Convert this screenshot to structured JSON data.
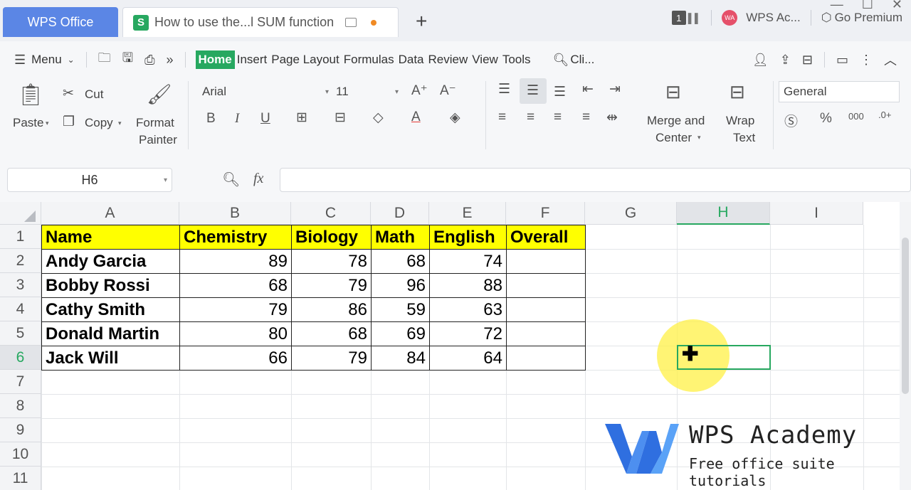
{
  "titlebar": {
    "app_tab": "WPS Office",
    "doc_tab": "How to use the...l SUM function",
    "doc_icon": "S",
    "new_tab": "+",
    "window_count": "1",
    "account_avatar": "WA",
    "account_name": "WPS Ac...",
    "premium": "Go Premium",
    "min": "—",
    "max": "☐",
    "close": "✕"
  },
  "menu": {
    "menu_label": "Menu",
    "more": "»",
    "tabs": [
      "Home",
      "Insert",
      "Page Layout",
      "Formulas",
      "Data",
      "Review",
      "View",
      "Tools"
    ],
    "search": "Cli..."
  },
  "ribbon": {
    "paste": "Paste",
    "cut": "Cut",
    "copy": "Copy",
    "format_painter_1": "Format",
    "format_painter_2": "Painter",
    "font_name": "Arial",
    "font_size": "11",
    "bold": "B",
    "italic": "I",
    "underline": "U",
    "merge_1": "Merge and",
    "merge_2": "Center",
    "wrap_1": "Wrap",
    "wrap_2": "Text",
    "number_format": "General"
  },
  "formula_bar": {
    "name_box": "H6",
    "fx": "fx",
    "formula": ""
  },
  "sheet": {
    "columns": [
      "A",
      "B",
      "C",
      "D",
      "E",
      "F",
      "G",
      "H",
      "I"
    ],
    "rows": [
      "1",
      "2",
      "3",
      "4",
      "5",
      "6",
      "7",
      "8",
      "9",
      "10",
      "11"
    ],
    "header": [
      "Name",
      "Chemistry",
      "Biology",
      "Math",
      "English",
      "Overall"
    ],
    "data": [
      [
        "Andy Garcia",
        "89",
        "78",
        "68",
        "74",
        ""
      ],
      [
        "Bobby Rossi",
        "68",
        "79",
        "96",
        "88",
        ""
      ],
      [
        "Cathy Smith",
        "79",
        "86",
        "59",
        "63",
        ""
      ],
      [
        "Donald Martin",
        "80",
        "68",
        "69",
        "72",
        ""
      ],
      [
        "Jack Will",
        "66",
        "79",
        "84",
        "64",
        ""
      ]
    ],
    "active_cell": "H6"
  },
  "watermark": {
    "title": "WPS Academy",
    "subtitle": "Free office suite tutorials"
  },
  "colors": {
    "accent": "#27a860",
    "header_fill": "#ffff00",
    "app_tab": "#5b86e5"
  }
}
